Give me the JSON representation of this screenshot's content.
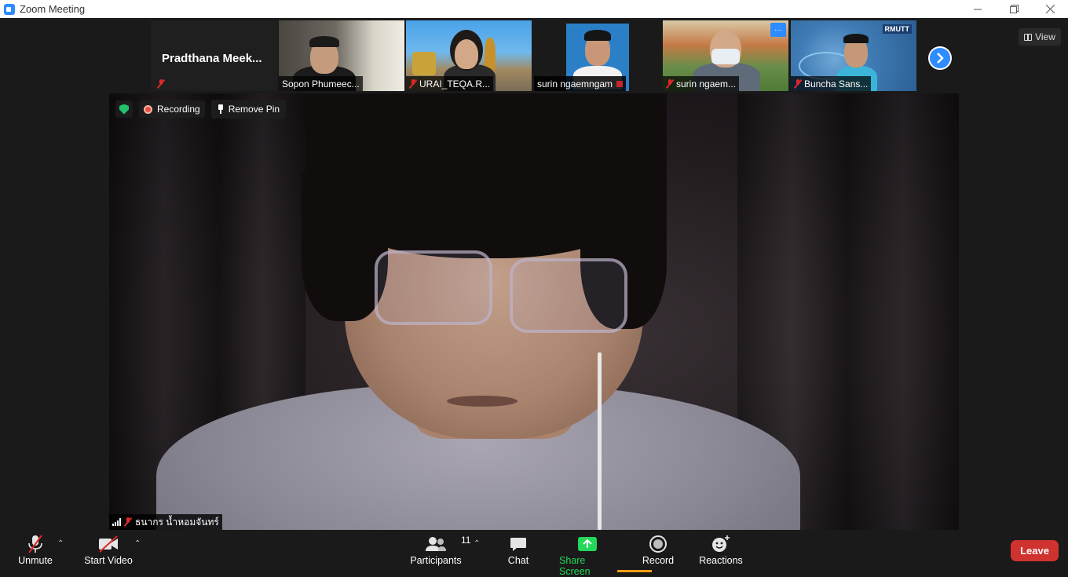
{
  "window": {
    "title": "Zoom Meeting",
    "minimize_icon": "minimize-icon",
    "restore_icon": "restore-icon",
    "close_icon": "close-icon"
  },
  "strip": {
    "featured_name": "Pradthana  Meek...",
    "tiles": [
      {
        "name": "Sopon Phumeec...",
        "muted": false
      },
      {
        "name": "URAI_TEQA.R...",
        "muted": true
      },
      {
        "name": "surin ngaemngam",
        "muted": false
      },
      {
        "name": "surin ngaem...",
        "muted": true
      },
      {
        "name": "Buncha Sans...",
        "muted": true
      }
    ],
    "tile4_badge": "RMUTT",
    "more_options_glyph": "···",
    "next_page_icon": "chevron-right-icon"
  },
  "view_button": {
    "label": "View",
    "icon": "grid-view-icon"
  },
  "main": {
    "recording_label": "Recording",
    "remove_pin_label": "Remove Pin",
    "speaker_name": "ธนากร น้ำหอมจันทร์",
    "security_icon": "shield-check-icon",
    "colors": {
      "security_green": "#23c16b",
      "recording_red": "#e8543f"
    }
  },
  "toolbar": {
    "unmute_label": "Unmute",
    "start_video_label": "Start Video",
    "participants_label": "Participants",
    "participants_count": "11",
    "chat_label": "Chat",
    "share_screen_label": "Share Screen",
    "record_label": "Record",
    "reactions_label": "Reactions",
    "leave_label": "Leave",
    "colors": {
      "share_green": "#23d959",
      "leave_red": "#d0332f",
      "accent_blue": "#2d8cff"
    }
  }
}
